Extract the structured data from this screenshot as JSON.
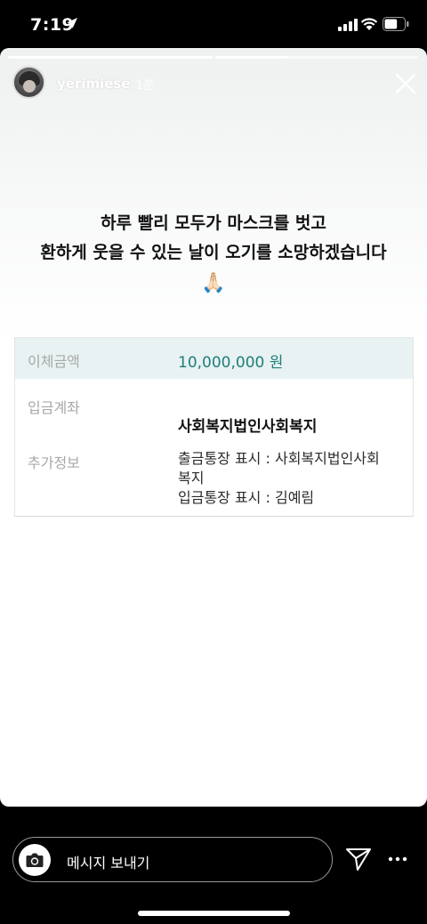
{
  "status_bar": {
    "time": "7:19",
    "battery_level": 0.65
  },
  "story": {
    "username": "yerimiese",
    "time_ago": "1분",
    "progress_current_segment": 0.36,
    "caption_line1": "하루 빨리 모두가 마스크를 벗고",
    "caption_line2": "환하게 웃을 수 있는 날이 오기를 소망하겠습니다",
    "caption_emoji": "🙏🏻"
  },
  "transfer": {
    "amount_label": "이체금액",
    "amount_value": "10,000,000 원",
    "account_label": "입금계좌",
    "account_value": "사회복지법인사회복지",
    "extra_label": "추가정보",
    "extra_line1": "출금통장 표시 : 사회복지법인사회",
    "extra_line2": "복지",
    "extra_line3": "입금통장 표시 : 김예림"
  },
  "reply_bar": {
    "placeholder": "메시지 보내기"
  },
  "icons": [
    "location-arrow-icon",
    "signal-icon",
    "wifi-icon",
    "battery-icon",
    "close-icon",
    "camera-icon",
    "send-icon",
    "more-icon"
  ]
}
